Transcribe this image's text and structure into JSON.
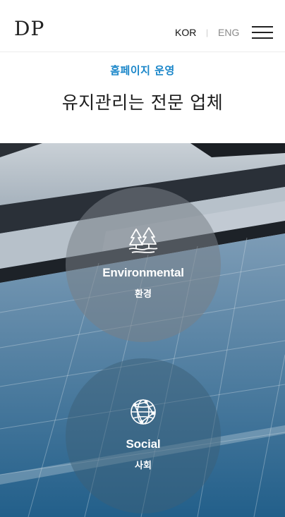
{
  "header": {
    "logo": "DP",
    "lang_kor": "KOR",
    "lang_sep": "|",
    "lang_eng": "ENG"
  },
  "intro": {
    "eyebrow": "홈페이지 운영",
    "headline": "유지관리는 전문 업체"
  },
  "cards": [
    {
      "title": "Environmental",
      "subtitle": "환경",
      "icon": "trees-icon"
    },
    {
      "title": "Social",
      "subtitle": "사회",
      "icon": "globe-network-icon"
    }
  ],
  "colors": {
    "accent": "#1a86c9",
    "text": "#1c1c1c"
  }
}
